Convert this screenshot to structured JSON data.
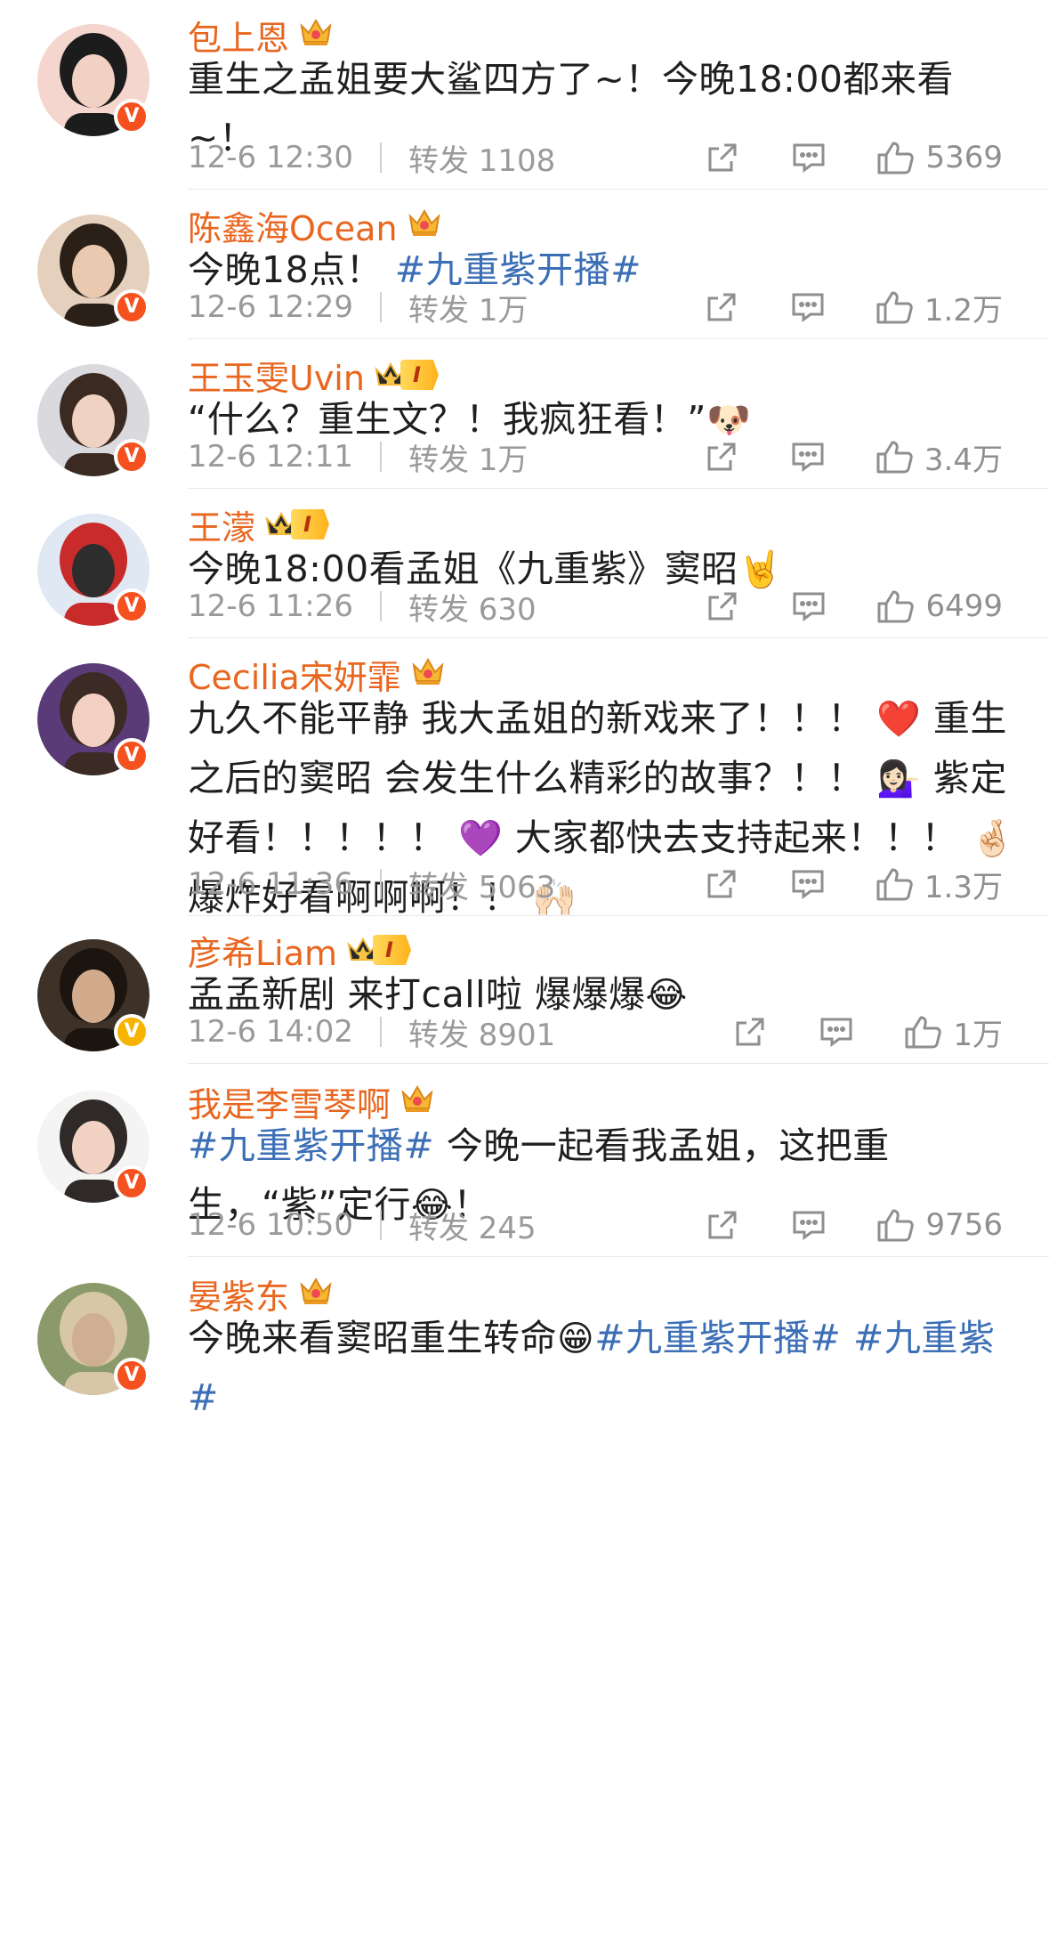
{
  "comments": [
    {
      "name": "包上恩",
      "text_parts": [
        {
          "t": "重生之孟姐要大鲨四方了~！今晚18:00都来看~！"
        }
      ],
      "time": "12-6 12:30",
      "repost": "转发 1108",
      "likes": "5369",
      "badge": "crown",
      "v": "orange"
    },
    {
      "name": "陈鑫海Ocean",
      "text_parts": [
        {
          "t": "今晚18点！ "
        },
        {
          "t": "#九重紫开播#",
          "tag": true
        }
      ],
      "time": "12-6 12:29",
      "repost": "转发 1万",
      "likes": "1.2万",
      "badge": "crown",
      "v": "orange"
    },
    {
      "name": "王玉雯Uvin",
      "text_parts": [
        {
          "t": "“什么？重生文？！我疯狂看！”"
        },
        {
          "emoji": "🐶"
        }
      ],
      "time": "12-6 12:11",
      "repost": "转发 1万",
      "likes": "3.4万",
      "badge": "level",
      "v": "orange"
    },
    {
      "name": "王濛",
      "text_parts": [
        {
          "t": "今晚18:00看孟姐《九重紫》窦昭"
        },
        {
          "emoji": "🤘"
        }
      ],
      "time": "12-6 11:26",
      "repost": "转发 630",
      "likes": "6499",
      "badge": "level",
      "v": "orange"
    },
    {
      "name": "Cecilia宋妍霏",
      "text_parts": [
        {
          "t": "九久不能平静 我大孟姐的新戏来了！！！ "
        },
        {
          "emoji": "❤️"
        },
        {
          "t": " 重生之后的窦昭 会发生什么精彩的故事？！！ "
        },
        {
          "emoji": "💁🏻‍♀️"
        },
        {
          "t": " 紫定好看！！！！！ "
        },
        {
          "emoji": "💜"
        },
        {
          "t": " 大家都快去支持起来！！！ "
        },
        {
          "emoji": "🤞🏻"
        },
        {
          "t": " 爆炸好看啊啊啊！！ "
        },
        {
          "emoji": "🙌🏻"
        }
      ],
      "time": "12-6 11:36",
      "repost": "转发 5063",
      "likes": "1.3万",
      "badge": "crown",
      "v": "orange"
    },
    {
      "name": "彦希Liam",
      "text_parts": [
        {
          "t": "孟孟新剧 来打call啦 爆爆爆"
        },
        {
          "emoji": "😂"
        }
      ],
      "time": "12-6 14:02",
      "repost": "转发 8901",
      "likes": "1万",
      "badge": "level",
      "v": "gold"
    },
    {
      "name": "我是李雪琴啊",
      "text_parts": [
        {
          "t": "#九重紫开播#",
          "tag": true
        },
        {
          "t": " 今晚一起看我孟姐，这把重生，“紫”定行"
        },
        {
          "emoji": "😂"
        },
        {
          "t": "！"
        }
      ],
      "time": "12-6 10:50",
      "repost": "转发 245",
      "likes": "9756",
      "badge": "crown",
      "v": "orange"
    },
    {
      "name": "晏紫东",
      "text_parts": [
        {
          "t": "今晚来看窦昭重生转命"
        },
        {
          "emoji": "😁"
        },
        {
          "t": "#九重紫开播#",
          "tag": true
        },
        {
          "t": " "
        },
        {
          "t": "#九重紫#",
          "tag": true
        }
      ],
      "time": "",
      "repost": "",
      "likes": "",
      "badge": "crown",
      "v": "orange"
    }
  ],
  "level_label": "I",
  "v_label": "V",
  "colors": {
    "name": "#e8661f",
    "tag": "#3c6fb6",
    "meta": "#9a9a9a",
    "vbadge": "#f5511f",
    "vbadge_gold": "#f6b400"
  },
  "icons": [
    "crown-icon",
    "level-badge-icon",
    "share-icon",
    "comment-icon",
    "like-icon"
  ]
}
